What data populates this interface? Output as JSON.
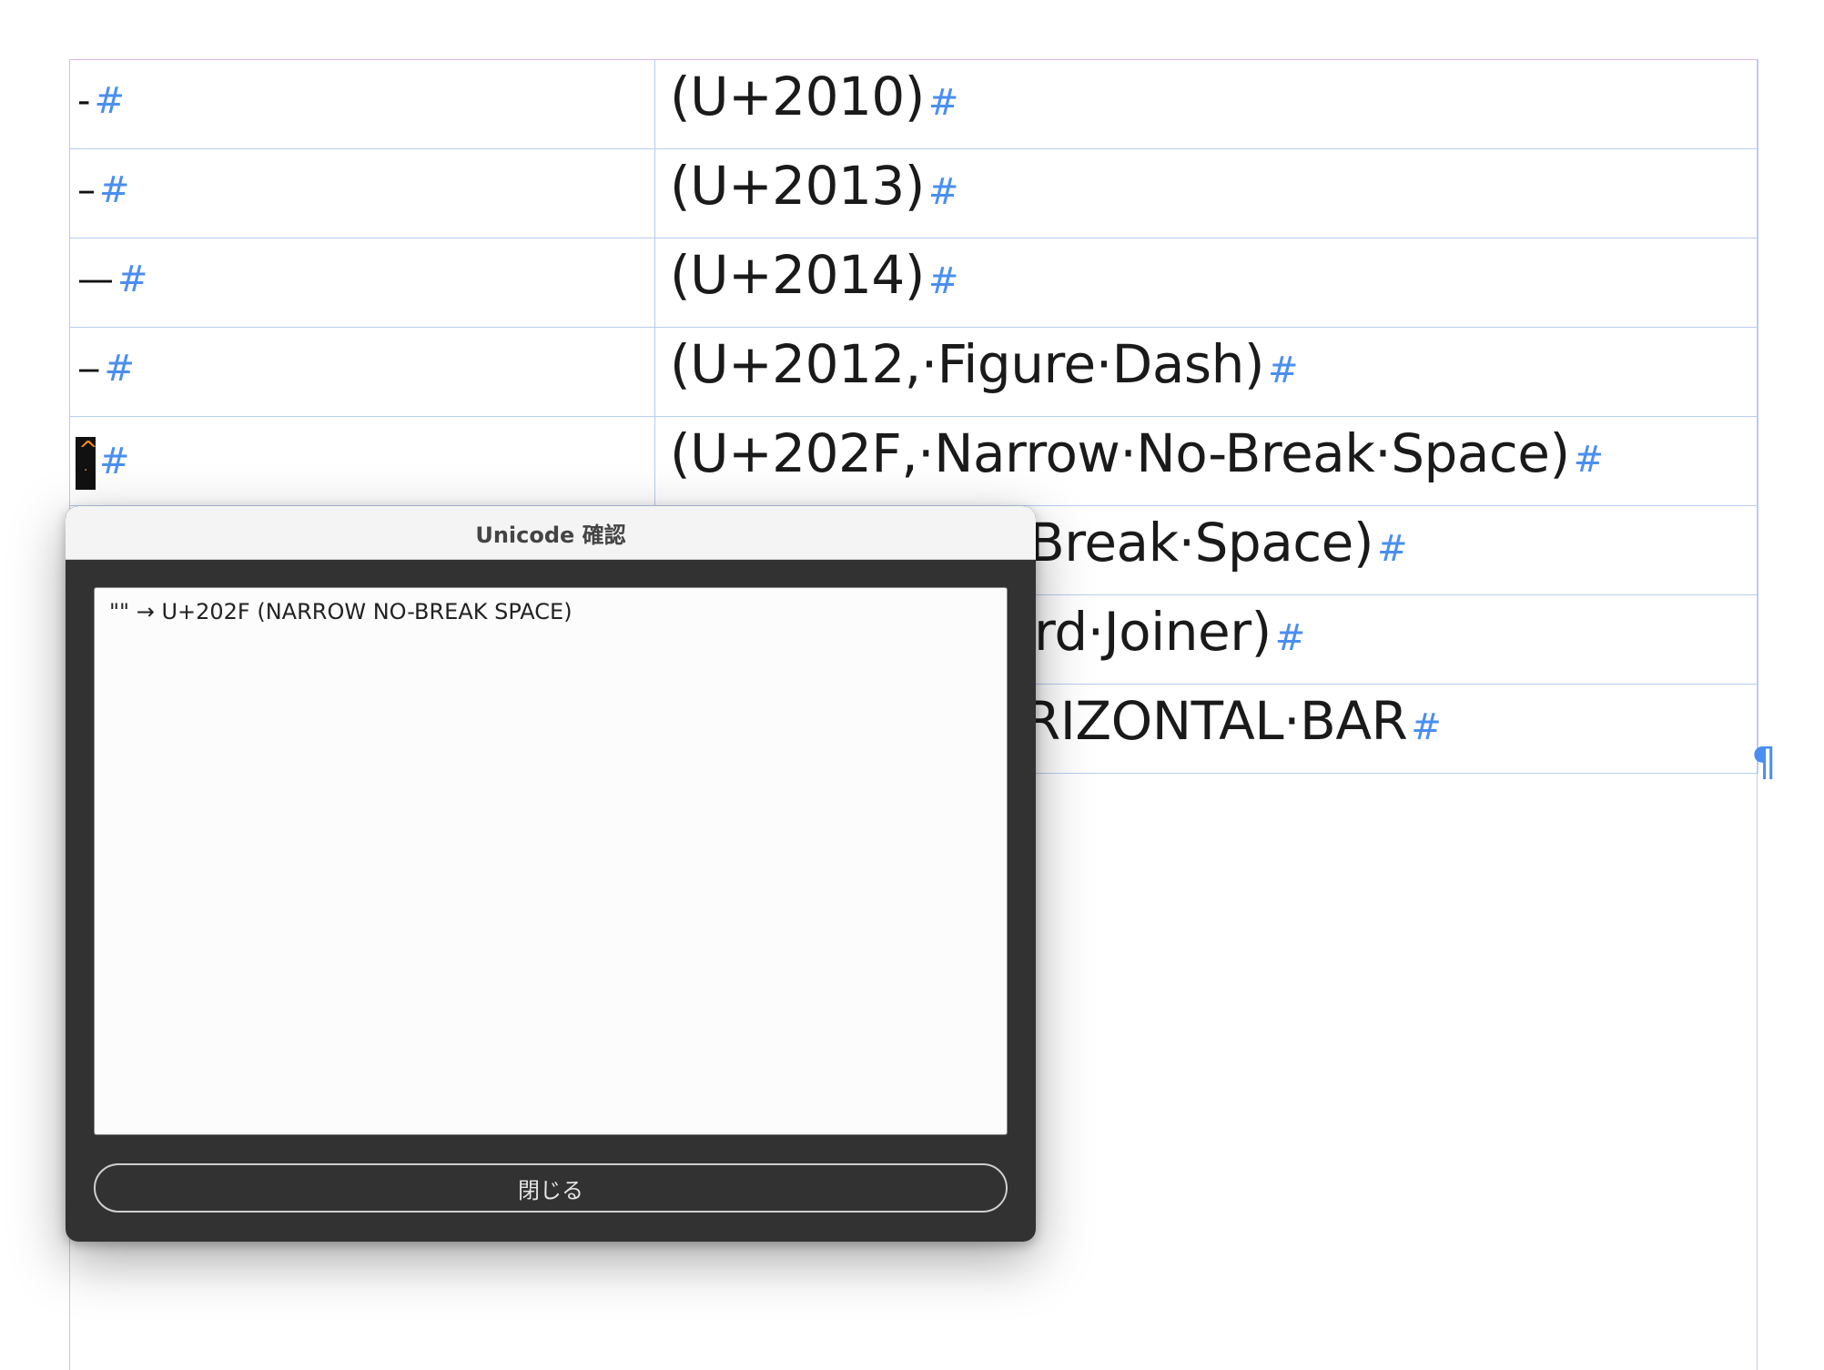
{
  "document": {
    "rows": [
      {
        "char": "‐",
        "mark": "#",
        "desc": "(U+2010)",
        "desc_mark": "#"
      },
      {
        "char": "–",
        "mark": "#",
        "desc": "(U+2013)",
        "desc_mark": "#"
      },
      {
        "char": "—",
        "mark": "#",
        "desc": "(U+2014)",
        "desc_mark": "#"
      },
      {
        "char": "‒",
        "mark": "#",
        "desc": "(U+2012,·Figure·Dash)",
        "desc_mark": "#"
      },
      {
        "char": "",
        "mark": "#",
        "desc": "(U+202F,·Narrow·No-Break·Space)",
        "desc_mark": "#"
      },
      {
        "char": "",
        "mark": "",
        "desc": "Break·Space)",
        "desc_mark": "#"
      },
      {
        "char": "",
        "mark": "",
        "desc": "rd·Joiner)",
        "desc_mark": "#"
      },
      {
        "char": "",
        "mark": "",
        "desc": "RIZONTAL·BAR",
        "desc_mark": "#"
      }
    ],
    "cursor_caret": "^",
    "cursor_dot": "·",
    "pilcrow": "¶"
  },
  "dialog": {
    "title": "Unicode 確認",
    "result_text": "\"\" → U+202F (NARROW NO-BREAK SPACE)",
    "close_label": "閉じる"
  },
  "colors": {
    "accent_blue": "#4a8ef0",
    "dialog_bg": "#323232",
    "cursor_highlight": "#f28c28"
  }
}
